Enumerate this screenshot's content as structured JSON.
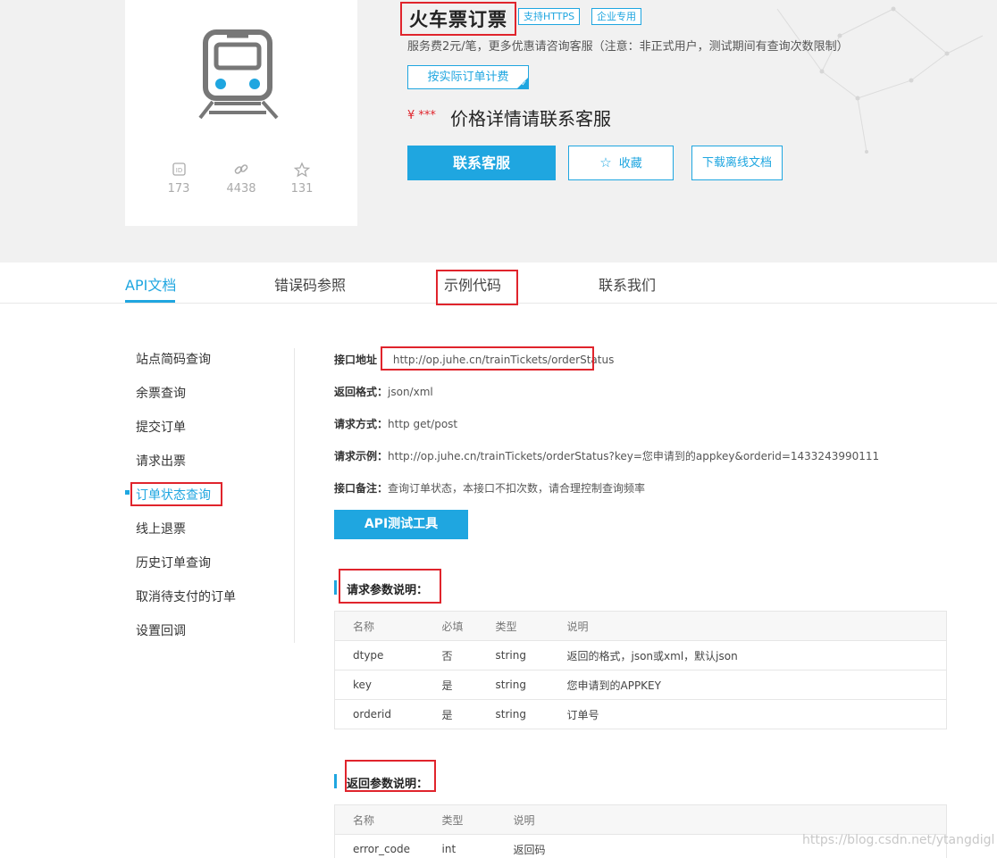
{
  "product": {
    "title": "火车票订票",
    "tags": [
      "支持HTTPS",
      "企业专用"
    ],
    "description": "服务费2元/笔，更多优惠请咨询客服（注意：非正式用户，测试期间有查询次数限制）",
    "billing_label": "按实际订单计费",
    "price_symbol": "¥ ***",
    "price_text": "价格详情请联系客服",
    "stats": [
      {
        "icon": "id-icon",
        "value": "173"
      },
      {
        "icon": "link-icon",
        "value": "4438"
      },
      {
        "icon": "star-icon",
        "value": "131"
      }
    ]
  },
  "actions": {
    "contact": "联系客服",
    "favorite": "收藏",
    "download": "下载离线文档"
  },
  "tabs": [
    {
      "label": "API文档",
      "active": true
    },
    {
      "label": "错误码参照",
      "active": false
    },
    {
      "label": "示例代码",
      "active": false
    },
    {
      "label": "联系我们",
      "active": false
    }
  ],
  "sidebar": {
    "items": [
      {
        "label": "站点简码查询"
      },
      {
        "label": "余票查询"
      },
      {
        "label": "提交订单"
      },
      {
        "label": "请求出票"
      },
      {
        "label": "订单状态查询",
        "active": true
      },
      {
        "label": "线上退票"
      },
      {
        "label": "历史订单查询"
      },
      {
        "label": "取消待支付的订单"
      },
      {
        "label": "设置回调"
      }
    ]
  },
  "api": {
    "url_label": "接口地址",
    "url": "http://op.juhe.cn/trainTickets/orderStatus",
    "format_label": "返回格式：",
    "format": "json/xml",
    "method_label": "请求方式：",
    "method": "http get/post",
    "example_label": "请求示例：",
    "example": "http://op.juhe.cn/trainTickets/orderStatus?key=您申请到的appkey&orderid=1433243990111",
    "note_label": "接口备注：",
    "note": "查询订单状态，本接口不扣次数，请合理控制查询频率",
    "test_button": "API测试工具"
  },
  "request_params": {
    "title": "请求参数说明：",
    "headers": [
      "名称",
      "必填",
      "类型",
      "说明"
    ],
    "rows": [
      [
        "dtype",
        "否",
        "string",
        "返回的格式，json或xml，默认json"
      ],
      [
        "key",
        "是",
        "string",
        "您申请到的APPKEY"
      ],
      [
        "orderid",
        "是",
        "string",
        "订单号"
      ]
    ]
  },
  "response_params": {
    "title": "返回参数说明：",
    "headers": [
      "名称",
      "类型",
      "说明"
    ],
    "rows": [
      [
        "error_code",
        "int",
        "返回码"
      ]
    ]
  },
  "watermark": "https://blog.csdn.net/ytangdigl",
  "colors": {
    "accent": "#1fa6e0",
    "highlight": "#e0242c",
    "header_bg": "#f1f1f1"
  }
}
